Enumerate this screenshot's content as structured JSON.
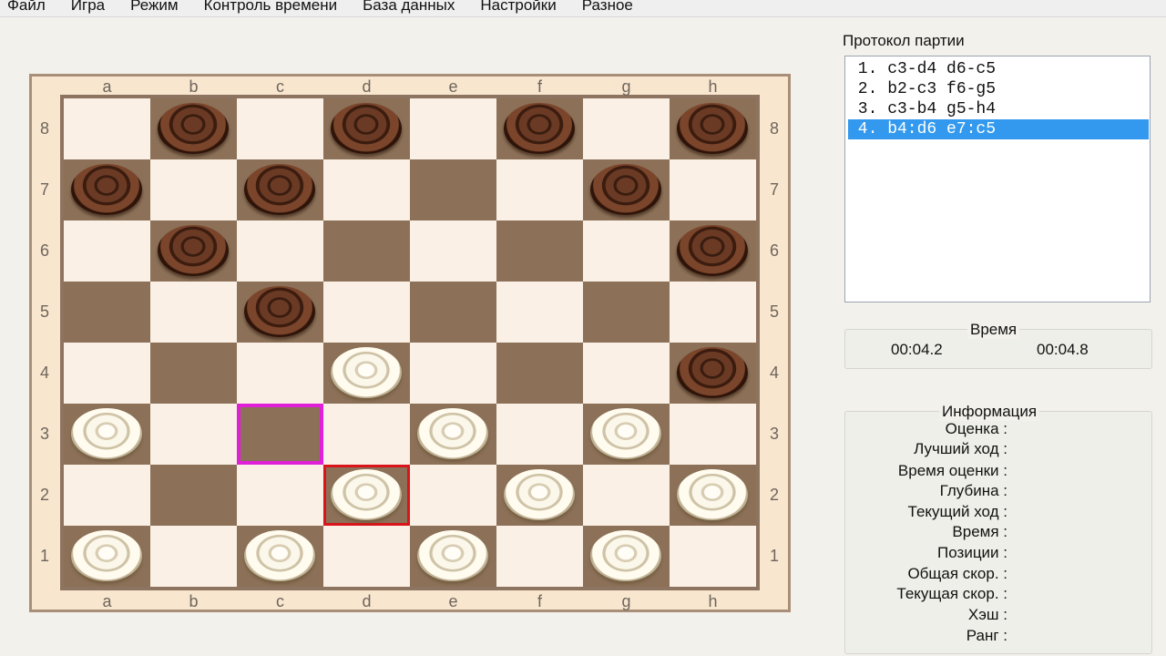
{
  "menu": [
    "Файл",
    "Игра",
    "Режим",
    "Контроль времени",
    "База данных",
    "Настройки",
    "Разное"
  ],
  "board": {
    "files": [
      "a",
      "b",
      "c",
      "d",
      "e",
      "f",
      "g",
      "h"
    ],
    "ranks": [
      "8",
      "7",
      "6",
      "5",
      "4",
      "3",
      "2",
      "1"
    ],
    "pieces": [
      {
        "square": "b8",
        "color": "black"
      },
      {
        "square": "d8",
        "color": "black"
      },
      {
        "square": "f8",
        "color": "black"
      },
      {
        "square": "h8",
        "color": "black"
      },
      {
        "square": "a7",
        "color": "black"
      },
      {
        "square": "c7",
        "color": "black"
      },
      {
        "square": "g7",
        "color": "black"
      },
      {
        "square": "b6",
        "color": "black"
      },
      {
        "square": "h6",
        "color": "black"
      },
      {
        "square": "c5",
        "color": "black"
      },
      {
        "square": "d4",
        "color": "white"
      },
      {
        "square": "h4",
        "color": "black"
      },
      {
        "square": "a3",
        "color": "white"
      },
      {
        "square": "e3",
        "color": "white"
      },
      {
        "square": "g3",
        "color": "white"
      },
      {
        "square": "d2",
        "color": "white"
      },
      {
        "square": "f2",
        "color": "white"
      },
      {
        "square": "h2",
        "color": "white"
      },
      {
        "square": "a1",
        "color": "white"
      },
      {
        "square": "c1",
        "color": "white"
      },
      {
        "square": "e1",
        "color": "white"
      },
      {
        "square": "g1",
        "color": "white"
      }
    ],
    "highlight_from": "c3",
    "highlight_to": "d2",
    "colors": {
      "light": "#faf0e6",
      "dark": "#8c7158",
      "from": "#e020d8",
      "to": "#d9141a"
    }
  },
  "protocol": {
    "title": "Протокол партии",
    "moves": [
      {
        "text": " 1. c3-d4 d6-c5",
        "selected": false
      },
      {
        "text": " 2. b2-c3 f6-g5",
        "selected": false
      },
      {
        "text": " 3. c3-b4 g5-h4",
        "selected": false
      },
      {
        "text": " 4. b4:d6 e7:c5",
        "selected": true
      }
    ]
  },
  "time": {
    "title": "Время",
    "white": "00:04.2",
    "black": "00:04.8"
  },
  "info": {
    "title": "Информация",
    "rows": [
      "Оценка :",
      "Лучший ход :",
      "Время оценки :",
      "Глубина :",
      "Текущий ход :",
      "Время :",
      "Позиции :",
      "Общая скор. :",
      "Текущая скор. :",
      "Хэш :",
      "Ранг :"
    ]
  }
}
